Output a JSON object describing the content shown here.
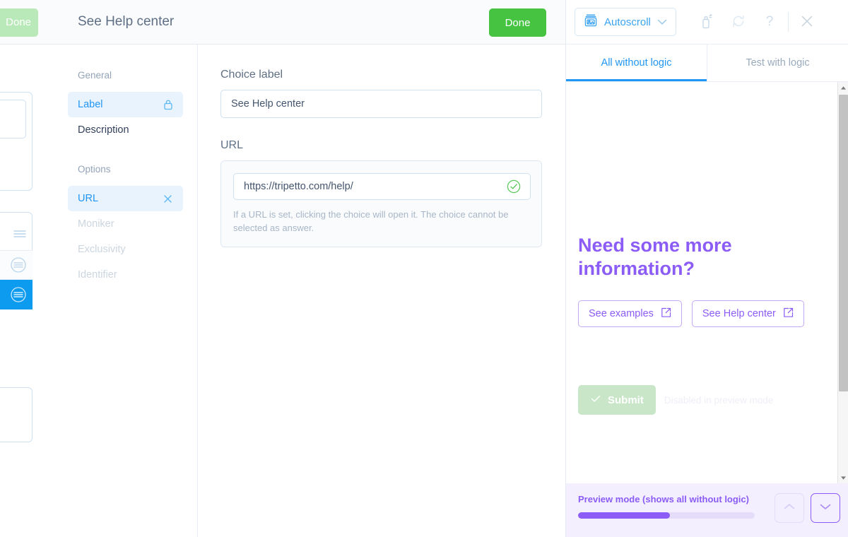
{
  "builder": {
    "done_label": "Done"
  },
  "editor": {
    "title": "See Help center",
    "done_label": "Done",
    "nav": {
      "group_general": "General",
      "group_options": "Options",
      "items": [
        {
          "label": "Label",
          "icon": "lock-icon",
          "state": "active"
        },
        {
          "label": "Description",
          "icon": "",
          "state": "normal"
        },
        {
          "label": "URL",
          "icon": "close-icon",
          "state": "active"
        },
        {
          "label": "Moniker",
          "icon": "",
          "state": "dim"
        },
        {
          "label": "Exclusivity",
          "icon": "",
          "state": "dim"
        },
        {
          "label": "Identifier",
          "icon": "",
          "state": "dim"
        }
      ]
    },
    "form": {
      "choice_label_title": "Choice label",
      "choice_label_value": "See Help center",
      "url_title": "URL",
      "url_value": "https://tripetto.com/help/",
      "url_hint": "If a URL is set, clicking the choice will open it. The choice cannot be selected as answer.",
      "url_valid_icon": "check-circle-icon"
    }
  },
  "preview": {
    "toolbar": {
      "autoscroll_label": "Autoscroll",
      "autoscroll_icon": "slideshow-icon",
      "chevron_icon": "chevron-down-icon",
      "clear_icon": "spray-can-icon",
      "restart_icon": "refresh-icon",
      "help_icon": "question-mark-icon",
      "close_icon": "close-icon"
    },
    "tabs": [
      {
        "label": "All without logic",
        "active": true
      },
      {
        "label": "Test with logic",
        "active": false
      }
    ],
    "content": {
      "heading": "Need some more information?",
      "choices": [
        {
          "label": "See examples",
          "icon": "external-link-icon"
        },
        {
          "label": "See Help center",
          "icon": "external-link-icon"
        }
      ],
      "submit_label": "Submit",
      "submit_icon": "check-icon",
      "submit_note": "Disabled in preview mode"
    },
    "footer": {
      "mode_label": "Preview mode (shows all without logic)",
      "progress_percent": 52,
      "prev_icon": "chevron-up-icon",
      "next_icon": "chevron-down-icon"
    }
  },
  "colors": {
    "accent_blue": "#2196f3",
    "green": "#45c341",
    "purple": "#8b5cf6"
  }
}
